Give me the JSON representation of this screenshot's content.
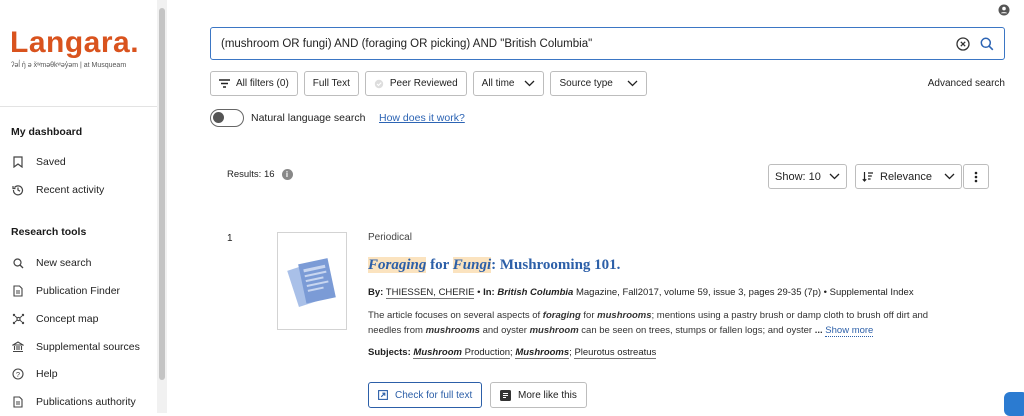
{
  "colors": {
    "brand": "#d9531e",
    "accent": "#2c5fa8",
    "highlight": "#fbe3bf"
  },
  "sidebar": {
    "logo": "Langara.",
    "logo_sub": "ʔəl̓ ŋ̓ ə x̌ʷməθkʷəy̓əm  |  at Musqueam",
    "dashboard_title": "My dashboard",
    "dashboard_items": [
      {
        "label": "Saved",
        "icon": "bookmark-icon"
      },
      {
        "label": "Recent activity",
        "icon": "history-icon"
      }
    ],
    "tools_title": "Research tools",
    "tools_items": [
      {
        "label": "New search",
        "icon": "search-icon"
      },
      {
        "label": "Publication Finder",
        "icon": "document-icon"
      },
      {
        "label": "Concept map",
        "icon": "concept-map-icon"
      },
      {
        "label": "Supplemental sources",
        "icon": "bank-icon"
      },
      {
        "label": "Help",
        "icon": "help-icon"
      },
      {
        "label": "Publications authority",
        "icon": "document-icon"
      }
    ]
  },
  "search": {
    "query": "(mushroom OR fungi) AND (foraging OR picking) AND \"British Columbia\""
  },
  "filters": {
    "all_filters": "All filters (0)",
    "full_text": "Full Text",
    "peer_reviewed": "Peer Reviewed",
    "all_time": "All time",
    "source_type": "Source type",
    "advanced": "Advanced search"
  },
  "nls": {
    "label": "Natural language search",
    "how": "How does it work?"
  },
  "results": {
    "count_label": "Results: 16",
    "show": "Show: 10",
    "sort": "Relevance"
  },
  "item": {
    "rank": "1",
    "type": "Periodical",
    "title_hl1": "Foraging",
    "title_mid": " for ",
    "title_hl2": "Fungi",
    "title_rest": ": Mushrooming 101.",
    "by_label": "By:",
    "author": "THIESSEN, CHERIE",
    "in_label": "In:",
    "source": "British Columbia",
    "source_rest": " Magazine, Fall2017, volume 59, issue 3, pages 29-35 (7p) • Supplemental Index",
    "abs1": "The article focuses on several aspects of ",
    "abs_b1": "foraging",
    "abs2": " for ",
    "abs_b2": "mushrooms",
    "abs3": "; mentions using a pastry brush or damp cloth to brush off dirt and needles from ",
    "abs_b3": "mushrooms",
    "abs4": " and oyster ",
    "abs_b4": "mushroom",
    "abs5": " can be seen on trees, stumps or fallen logs; and oyster ",
    "abs_ellipsis": "...",
    "show_more": "Show more",
    "subjects_label": "Subjects:",
    "subj1_b": "Mushroom",
    "subj1_rest": " Production",
    "subj2_b": "Mushrooms",
    "subj3": "Pleurotus ostreatus",
    "btn_full": "Check for full text",
    "btn_more": "More like this"
  }
}
